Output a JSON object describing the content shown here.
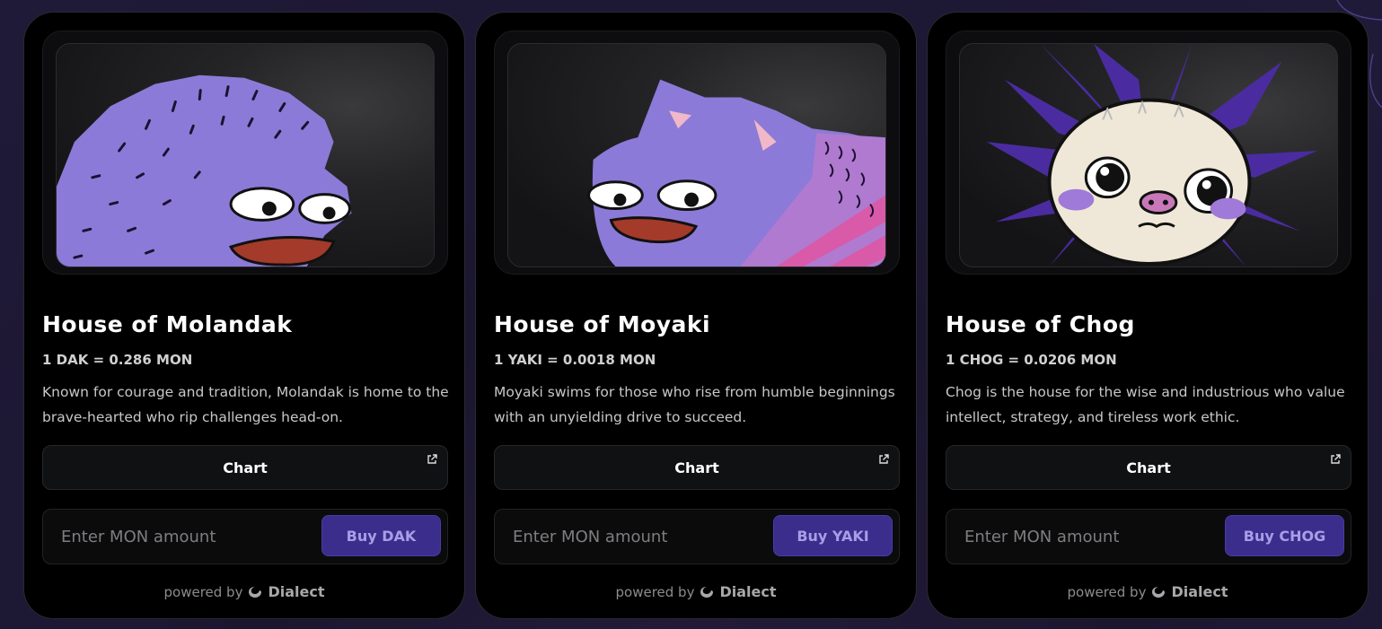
{
  "cards": [
    {
      "title": "House of Molandak",
      "rate": "1 DAK = 0.286 MON",
      "description": "Known for courage and tradition, Molandak is home to the brave-hearted who rip challenges head-on.",
      "chart_label": "Chart",
      "input_placeholder": "Enter MON amount",
      "buy_label": "Buy DAK",
      "powered_by": "powered by",
      "brand": "Dialect",
      "image_icon": "molandak-hedgehog-image"
    },
    {
      "title": "House of Moyaki",
      "rate": "1 YAKI = 0.0018 MON",
      "description": "Moyaki swims for those who rise from humble beginnings with an unyielding drive to succeed.",
      "chart_label": "Chart",
      "input_placeholder": "Enter MON amount",
      "buy_label": "Buy YAKI",
      "powered_by": "powered by",
      "brand": "Dialect",
      "image_icon": "moyaki-fish-image"
    },
    {
      "title": "House of Chog",
      "rate": "1 CHOG = 0.0206 MON",
      "description": "Chog is the house for the wise and industrious who value intellect, strategy, and tireless work ethic.",
      "chart_label": "Chart",
      "input_placeholder": "Enter MON amount",
      "buy_label": "Buy CHOG",
      "powered_by": "powered by",
      "brand": "Dialect",
      "image_icon": "chog-creature-image"
    }
  ],
  "colors": {
    "background": "#1b1630",
    "card": "#000000",
    "buy_button": "#3a2d8c",
    "buy_text": "#a89ee6",
    "mascot_purple": "#8a7ad6"
  }
}
